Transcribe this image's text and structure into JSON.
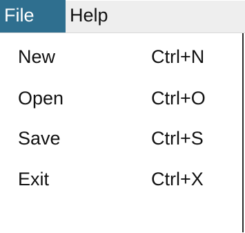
{
  "menubar": {
    "menus": [
      {
        "label": "File",
        "active": true
      },
      {
        "label": "Help",
        "active": false
      }
    ]
  },
  "file_menu": {
    "items": [
      {
        "label": "New",
        "shortcut": "Ctrl+N"
      },
      {
        "label": "Open",
        "shortcut": "Ctrl+O"
      },
      {
        "label": "Save",
        "shortcut": "Ctrl+S"
      },
      {
        "label": "Exit",
        "shortcut": "Ctrl+X"
      }
    ]
  },
  "colors": {
    "menubar_bg": "#eeeeee",
    "active_menu_bg": "#2f6f8f",
    "active_menu_text": "#ffffff",
    "dropdown_bg": "#ffffff",
    "text": "#111111"
  }
}
